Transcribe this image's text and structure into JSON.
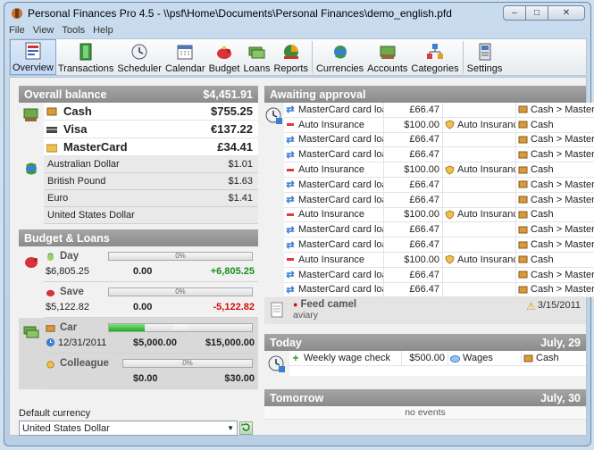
{
  "window": {
    "title": "Personal Finances Pro 4.5 - \\\\psf\\Home\\Documents\\Personal Finances\\demo_english.pfd",
    "buttons": {
      "minimize": "–",
      "maximize": "□",
      "close": "✕"
    }
  },
  "menu": [
    "File",
    "View",
    "Tools",
    "Help"
  ],
  "toolbar": {
    "groups": [
      [
        {
          "label": "Overview",
          "icon": "overview-icon",
          "active": true
        },
        {
          "label": "Transactions",
          "icon": "transactions-icon"
        },
        {
          "label": "Scheduler",
          "icon": "scheduler-icon"
        },
        {
          "label": "Calendar",
          "icon": "calendar-icon"
        },
        {
          "label": "Budget",
          "icon": "budget-icon"
        },
        {
          "label": "Loans",
          "icon": "loans-icon"
        },
        {
          "label": "Reports",
          "icon": "reports-icon"
        }
      ],
      [
        {
          "label": "Currencies",
          "icon": "currencies-icon"
        },
        {
          "label": "Accounts",
          "icon": "accounts-icon"
        },
        {
          "label": "Categories",
          "icon": "categories-icon"
        }
      ],
      [
        {
          "label": "Settings",
          "icon": "settings-icon"
        }
      ]
    ]
  },
  "overall_balance": {
    "title": "Overall balance",
    "total": "$4,451.91",
    "accounts": [
      {
        "name": "Cash",
        "value": "$755.25",
        "icon": "cash-icon"
      },
      {
        "name": "Visa",
        "value": "€137.22",
        "icon": "visa-card-icon"
      },
      {
        "name": "MasterCard",
        "value": "£34.41",
        "icon": "mastercard-icon"
      }
    ],
    "currencies": [
      {
        "name": "Australian Dollar",
        "value": "$1.01"
      },
      {
        "name": "British Pound",
        "value": "$1.63"
      },
      {
        "name": "Euro",
        "value": "$1.41"
      },
      {
        "name": "United States Dollar",
        "value": ""
      }
    ]
  },
  "budget_loans": {
    "title": "Budget & Loans",
    "budgets": [
      {
        "name": "Day",
        "amount": "$6,805.25",
        "percent_label": "0%",
        "progress": 0,
        "spent": "0.00",
        "remaining": "+6,805.25",
        "remaining_type": "pos"
      },
      {
        "name": "Save",
        "amount": "$5,122.82",
        "percent_label": "0%",
        "progress": 0,
        "spent": "0.00",
        "remaining": "-5,122.82",
        "remaining_type": "neg"
      }
    ],
    "loans": [
      {
        "name": "Car",
        "date": "12/31/2011",
        "percent_label": "25%",
        "progress": 0.25,
        "paid": "$5,000.00",
        "total": "$15,000.00"
      },
      {
        "name": "Colleague",
        "date": "",
        "percent_label": "0%",
        "progress": 0,
        "paid": "$0.00",
        "total": "$30.00"
      }
    ]
  },
  "default_currency": {
    "label": "Default currency",
    "value": "United States Dollar"
  },
  "awaiting": {
    "title": "Awaiting approval",
    "rows": [
      {
        "type": "transfer",
        "desc": "MasterCard card loan",
        "amount": "£66.47",
        "category": "",
        "account": "Cash > MasterCard"
      },
      {
        "type": "expense",
        "desc": "Auto Insurance",
        "amount": "$100.00",
        "category": "Auto Insurance",
        "account": "Cash"
      },
      {
        "type": "transfer",
        "desc": "MasterCard card loan",
        "amount": "£66.47",
        "category": "",
        "account": "Cash > MasterCard"
      },
      {
        "type": "transfer",
        "desc": "MasterCard card loan",
        "amount": "£66.47",
        "category": "",
        "account": "Cash > MasterCard"
      },
      {
        "type": "expense",
        "desc": "Auto Insurance",
        "amount": "$100.00",
        "category": "Auto Insurance",
        "account": "Cash"
      },
      {
        "type": "transfer",
        "desc": "MasterCard card loan",
        "amount": "£66.47",
        "category": "",
        "account": "Cash > MasterCard"
      },
      {
        "type": "transfer",
        "desc": "MasterCard card loan",
        "amount": "£66.47",
        "category": "",
        "account": "Cash > MasterCard"
      },
      {
        "type": "expense",
        "desc": "Auto Insurance",
        "amount": "$100.00",
        "category": "Auto Insurance",
        "account": "Cash"
      },
      {
        "type": "transfer",
        "desc": "MasterCard card loan",
        "amount": "£66.47",
        "category": "",
        "account": "Cash > MasterCard"
      },
      {
        "type": "transfer",
        "desc": "MasterCard card loan",
        "amount": "£66.47",
        "category": "",
        "account": "Cash > MasterCard"
      },
      {
        "type": "expense",
        "desc": "Auto Insurance",
        "amount": "$100.00",
        "category": "Auto Insurance",
        "account": "Cash"
      },
      {
        "type": "transfer",
        "desc": "MasterCard card loan",
        "amount": "£66.47",
        "category": "",
        "account": "Cash > MasterCard"
      },
      {
        "type": "transfer",
        "desc": "MasterCard card loan",
        "amount": "£66.47",
        "category": "",
        "account": "Cash > MasterCard"
      }
    ],
    "task": {
      "title": "Feed camel",
      "subtitle": "aviary",
      "date": "3/15/2011"
    }
  },
  "today": {
    "title": "Today",
    "date": "July, 29",
    "rows": [
      {
        "type": "income",
        "desc": "Weekly wage check",
        "amount": "$500.00",
        "category": "Wages",
        "account": "Cash"
      }
    ]
  },
  "tomorrow": {
    "title": "Tomorrow",
    "date": "July, 30",
    "empty_text": "no events"
  },
  "colors": {
    "panel_header": "#9a9a9a",
    "positive": "#1b8f1b",
    "negative": "#d01010",
    "progress_fill": "#2fb52f",
    "window_frame": "#b9cfe6"
  }
}
